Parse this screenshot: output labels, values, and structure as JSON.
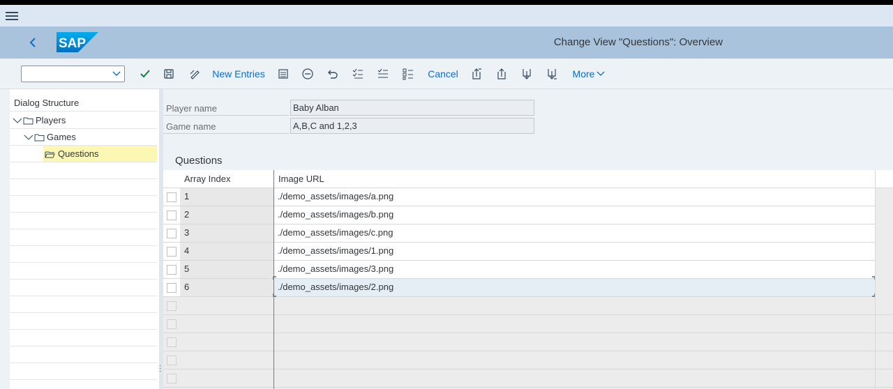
{
  "shell": {
    "title": "Change View \"Questions\": Overview",
    "logo_text": "SAP"
  },
  "toolbar": {
    "select_value": "",
    "new_entries": "New Entries",
    "cancel": "Cancel",
    "more": "More"
  },
  "dialog_structure": {
    "header": "Dialog Structure",
    "items": [
      {
        "label": "Players",
        "level": 0,
        "selected": false
      },
      {
        "label": "Games",
        "level": 1,
        "selected": false
      },
      {
        "label": "Questions",
        "level": 2,
        "selected": true
      }
    ]
  },
  "fields": {
    "player_name_label": "Player name",
    "player_name_value": "Baby Alban",
    "game_name_label": "Game name",
    "game_name_value": "A,B,C and 1,2,3"
  },
  "table": {
    "title": "Questions",
    "columns": [
      "Array Index",
      "Image URL"
    ],
    "rows": [
      {
        "index": "1",
        "url": "./demo_assets/images/a.png"
      },
      {
        "index": "2",
        "url": "./demo_assets/images/b.png"
      },
      {
        "index": "3",
        "url": "./demo_assets/images/c.png"
      },
      {
        "index": "4",
        "url": "./demo_assets/images/1.png"
      },
      {
        "index": "5",
        "url": "./demo_assets/images/3.png"
      },
      {
        "index": "6",
        "url": "./demo_assets/images/2.png"
      }
    ]
  },
  "colors": {
    "accent": "#0a6ed1",
    "shell_bg": "#a9c3dc",
    "selected_tree_bg": "#fcf8b3"
  }
}
